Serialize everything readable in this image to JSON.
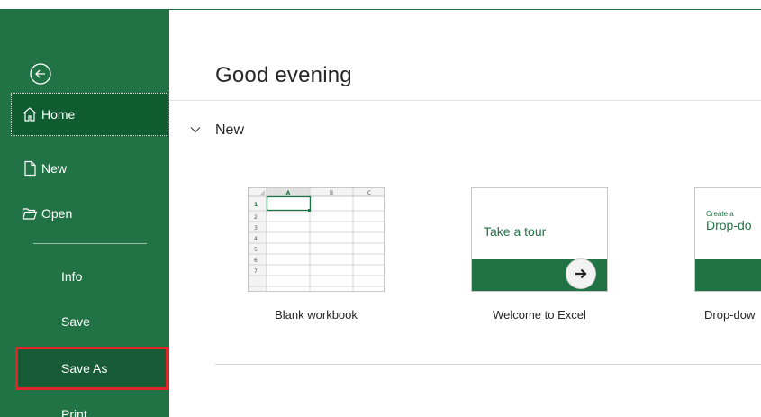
{
  "sidebar": {
    "back_label": "",
    "items": {
      "home": "Home",
      "new": "New",
      "open": "Open",
      "info": "Info",
      "save": "Save",
      "save_as": "Save As",
      "print": "Print"
    }
  },
  "main": {
    "greeting": "Good evening",
    "section_title": "New",
    "templates": [
      {
        "caption": "Blank workbook"
      },
      {
        "caption": "Welcome to Excel",
        "tile_text": "Take a tour"
      },
      {
        "caption": "Drop-dow",
        "tile_small": "Create a",
        "tile_big": "Drop-do"
      }
    ],
    "grid": {
      "columns": [
        "A",
        "B",
        "C"
      ],
      "rows": [
        "1",
        "2",
        "3",
        "4",
        "5",
        "6",
        "7"
      ]
    }
  },
  "colors": {
    "brand_green": "#217346",
    "selected_green": "#0e5c2f",
    "highlight_red": "#e0262b"
  }
}
